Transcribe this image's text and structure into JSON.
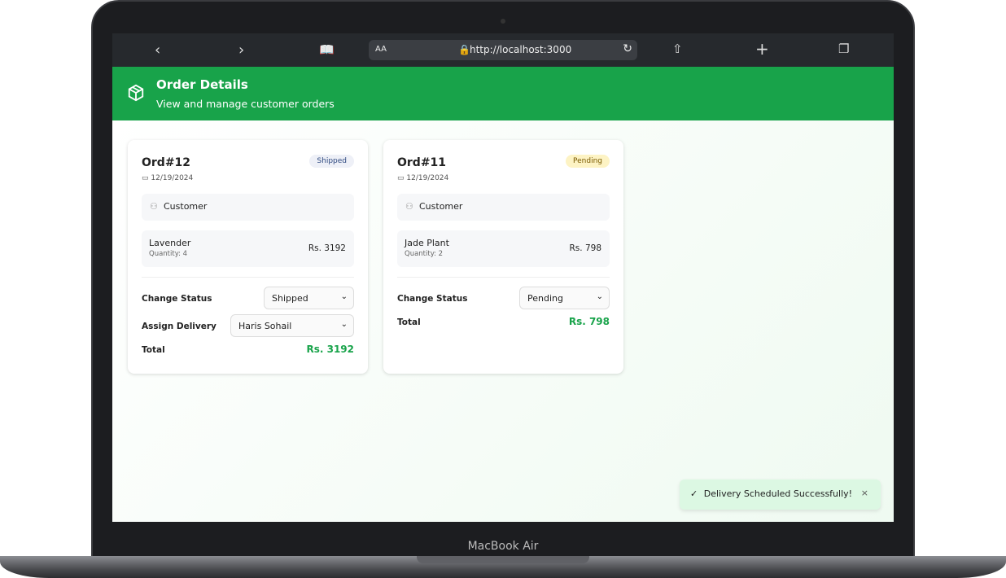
{
  "browser": {
    "url": "http://localhost:3000",
    "reader": "AA"
  },
  "header": {
    "title": "Order Details",
    "subtitle": "View and manage customer orders"
  },
  "orders": [
    {
      "id": "Ord#12",
      "status": "Shipped",
      "date": "12/19/2024",
      "customer": "Customer",
      "item": "Lavender",
      "quantity": "Quantity: 4",
      "price": "Rs. 3192",
      "change_status_label": "Change Status",
      "status_value": "Shipped",
      "assign_label": "Assign Delivery",
      "assign_value": "Haris Sohail",
      "total_label": "Total",
      "total": "Rs. 3192"
    },
    {
      "id": "Ord#11",
      "status": "Pending",
      "date": "12/19/2024",
      "customer": "Customer",
      "item": "Jade Plant",
      "quantity": "Quantity: 2",
      "price": "Rs. 798",
      "change_status_label": "Change Status",
      "status_value": "Pending",
      "total_label": "Total",
      "total": "Rs. 798"
    }
  ],
  "toast": {
    "message": "Delivery Scheduled Successfully!",
    "close": "×"
  },
  "device": {
    "label": "MacBook Air"
  },
  "colors": {
    "accent": "#18a34a",
    "shipped_badge": "#eef0f7",
    "pending_badge": "#fdf3c4"
  }
}
